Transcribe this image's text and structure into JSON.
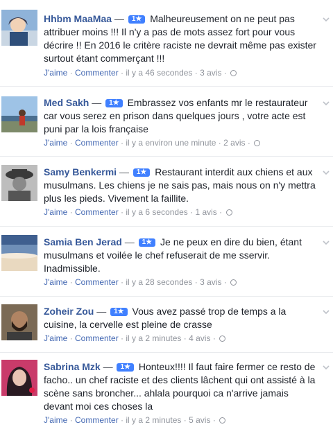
{
  "reviews": [
    {
      "name": "Hhbm MaaMaa",
      "dash": "—",
      "badge": "1★",
      "text": "Malheureusement on ne peut pas attribuer moins !!! Il n'y a pas de mots assez fort pour vous décrire !! En 2016 le critère raciste ne devrait même pas exister surtout étant commerçant !!!",
      "like": "J'aime",
      "comment": "Commenter",
      "time": "il y a 46 secondes",
      "reviews": "3 avis"
    },
    {
      "name": "Med Sakh",
      "dash": "—",
      "badge": "1★",
      "text": "Embrassez vos enfants mr le restaurateur car vous serez en prison dans quelques jours , votre acte est puni par la lois française",
      "like": "J'aime",
      "comment": "Commenter",
      "time": "il y a environ une minute",
      "reviews": "2 avis"
    },
    {
      "name": "Samy Benkermi",
      "dash": "—",
      "badge": "1★",
      "text": "Restaurant interdit aux chiens et aux musulmans. Les chiens je ne sais pas, mais nous on n'y mettra plus les pieds. Vivement la faillite.",
      "like": "J'aime",
      "comment": "Commenter",
      "time": "il y a 6 secondes",
      "reviews": "1 avis"
    },
    {
      "name": "Samia Ben Jerad",
      "dash": "—",
      "badge": "1★",
      "text": "Je ne peux en dire du bien, étant musulmans et voilée le chef refuserait de me sservir. Inadmissible.",
      "like": "J'aime",
      "comment": "Commenter",
      "time": "il y a 28 secondes",
      "reviews": "3 avis"
    },
    {
      "name": "Zoheir Zou",
      "dash": "—",
      "badge": "1★",
      "text": "Vous avez passé trop de temps a la cuisine, la cervelle est pleine de crasse",
      "like": "J'aime",
      "comment": "Commenter",
      "time": "il y a 2 minutes",
      "reviews": "4 avis"
    },
    {
      "name": "Sabrina Mzk",
      "dash": "—",
      "badge": "1★",
      "text": "Honteux!!!! Il faut faire fermer ce resto de facho.. un chef raciste et des clients lâchent qui ont assisté à la scène sans broncher... ahlala pourquoi ca n'arrive jamais devant moi ces choses la",
      "like": "J'aime",
      "comment": "Commenter",
      "time": "il y a 2 minutes",
      "reviews": "5 avis"
    }
  ],
  "meta_separator": "·",
  "icons": {
    "privacy": "globe-icon",
    "menu": "chevron-down-icon"
  },
  "colors": {
    "name": "#365899",
    "badge": "#4080ff",
    "action": "#4267b2",
    "meta": "#90949c",
    "divider": "#e9ebee"
  }
}
